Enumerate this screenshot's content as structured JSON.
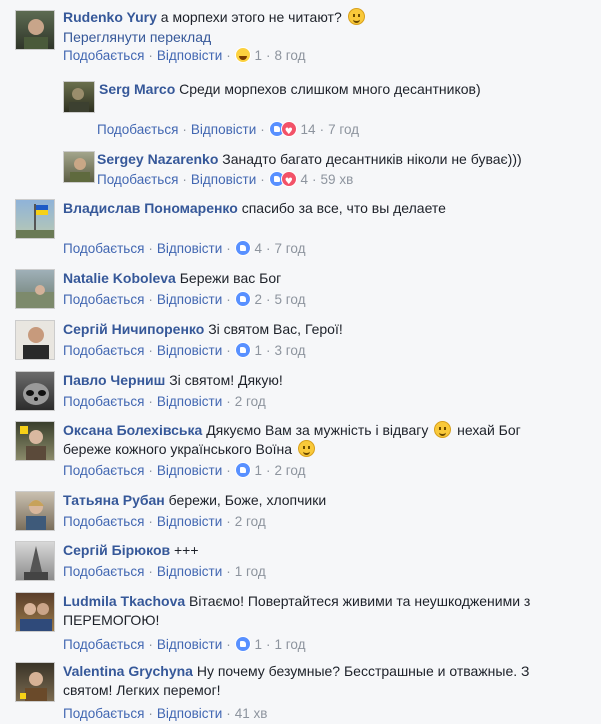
{
  "actions": {
    "like": "Подобається",
    "reply": "Відповісти"
  },
  "comments": [
    {
      "author": "Rudenko Yury",
      "text": "а морпехи этого не читают?",
      "translate": "Переглянути переклад",
      "count": "1",
      "time": "8 год"
    },
    {
      "author": "Serg Marco",
      "text": "Среди морпехов слишком много десантников)",
      "count": "14",
      "time": "7 год"
    },
    {
      "author": "Sergey Nazarenko",
      "text": "Занадто багато десантників ніколи не буває)))",
      "count": "4",
      "time": "59 хв"
    },
    {
      "author": "Владислав Пономаренко",
      "text": "спасибо за все, что вы делаете",
      "count": "4",
      "time": "7 год"
    },
    {
      "author": "Natalie Koboleva",
      "text": "Бережи вас Бог",
      "count": "2",
      "time": "5 год"
    },
    {
      "author": "Сергій Ничипоренко",
      "text": "Зі святом Вас, Герої!",
      "count": "1",
      "time": "3 год"
    },
    {
      "author": "Павло Черниш",
      "text": "Зі святом! Дякую!",
      "time": "2 год"
    },
    {
      "author": "Оксана Болехівська",
      "text1": "Дякуємо Вам за мужність і відвагу",
      "text2": "нехай Бог",
      "text3": "береже кожного українського Воїна",
      "count": "1",
      "time": "2 год"
    },
    {
      "author": "Татьяна Рубан",
      "text": "бережи, Боже, хлопчики",
      "time": "2 год"
    },
    {
      "author": "Сергій Бірюков",
      "text": "+++",
      "time": "1 год"
    },
    {
      "author": "Ludmila Tkachova",
      "text1": "Вітаємо! Повертайтеся живими та неушкодженими з",
      "text2": "ПЕРЕМОГОЮ!",
      "count": "1",
      "time": "1 год"
    },
    {
      "author": "Valentina Grychyna",
      "text1": "Ну почему безумные? Бесстрашные и отважные. З",
      "text2": "святом! Легких перемог!",
      "time": "41 хв"
    }
  ]
}
